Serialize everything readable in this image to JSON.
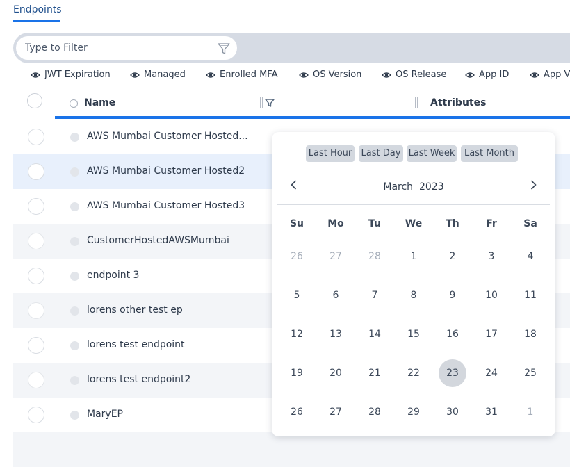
{
  "tab": {
    "label": "Endpoints"
  },
  "filter": {
    "placeholder": "Type to Filter"
  },
  "columns": [
    "JWT Expiration",
    "Managed",
    "Enrolled MFA",
    "OS Version",
    "OS Release",
    "App ID",
    "App Ve"
  ],
  "header": {
    "name": "Name",
    "attributes": "Attributes"
  },
  "rows": [
    "AWS Mumbai Customer Hosted...",
    "AWS Mumbai Customer Hosted2",
    "AWS Mumbai Customer Hosted3",
    "CustomerHostedAWSMumbai",
    "endpoint 3",
    "lorens other test ep",
    "lorens test endpoint",
    "lorens test endpoint2",
    "MaryEP"
  ],
  "calendar": {
    "quick_ranges": [
      "Last Hour",
      "Last Day",
      "Last Week",
      "Last Month"
    ],
    "month": "March",
    "year": "2023",
    "weekdays": [
      "Su",
      "Mo",
      "Tu",
      "We",
      "Th",
      "Fr",
      "Sa"
    ],
    "weeks": [
      [
        "26",
        "27",
        "28",
        "1",
        "2",
        "3",
        "4"
      ],
      [
        "5",
        "6",
        "7",
        "8",
        "9",
        "10",
        "11"
      ],
      [
        "12",
        "13",
        "14",
        "15",
        "16",
        "17",
        "18"
      ],
      [
        "19",
        "20",
        "21",
        "22",
        "23",
        "24",
        "25"
      ],
      [
        "26",
        "27",
        "28",
        "29",
        "30",
        "31",
        "1"
      ]
    ],
    "selected_day": "23",
    "colors": {
      "accent": "#1a73e8",
      "today_bg": "#d3d7dd"
    }
  }
}
